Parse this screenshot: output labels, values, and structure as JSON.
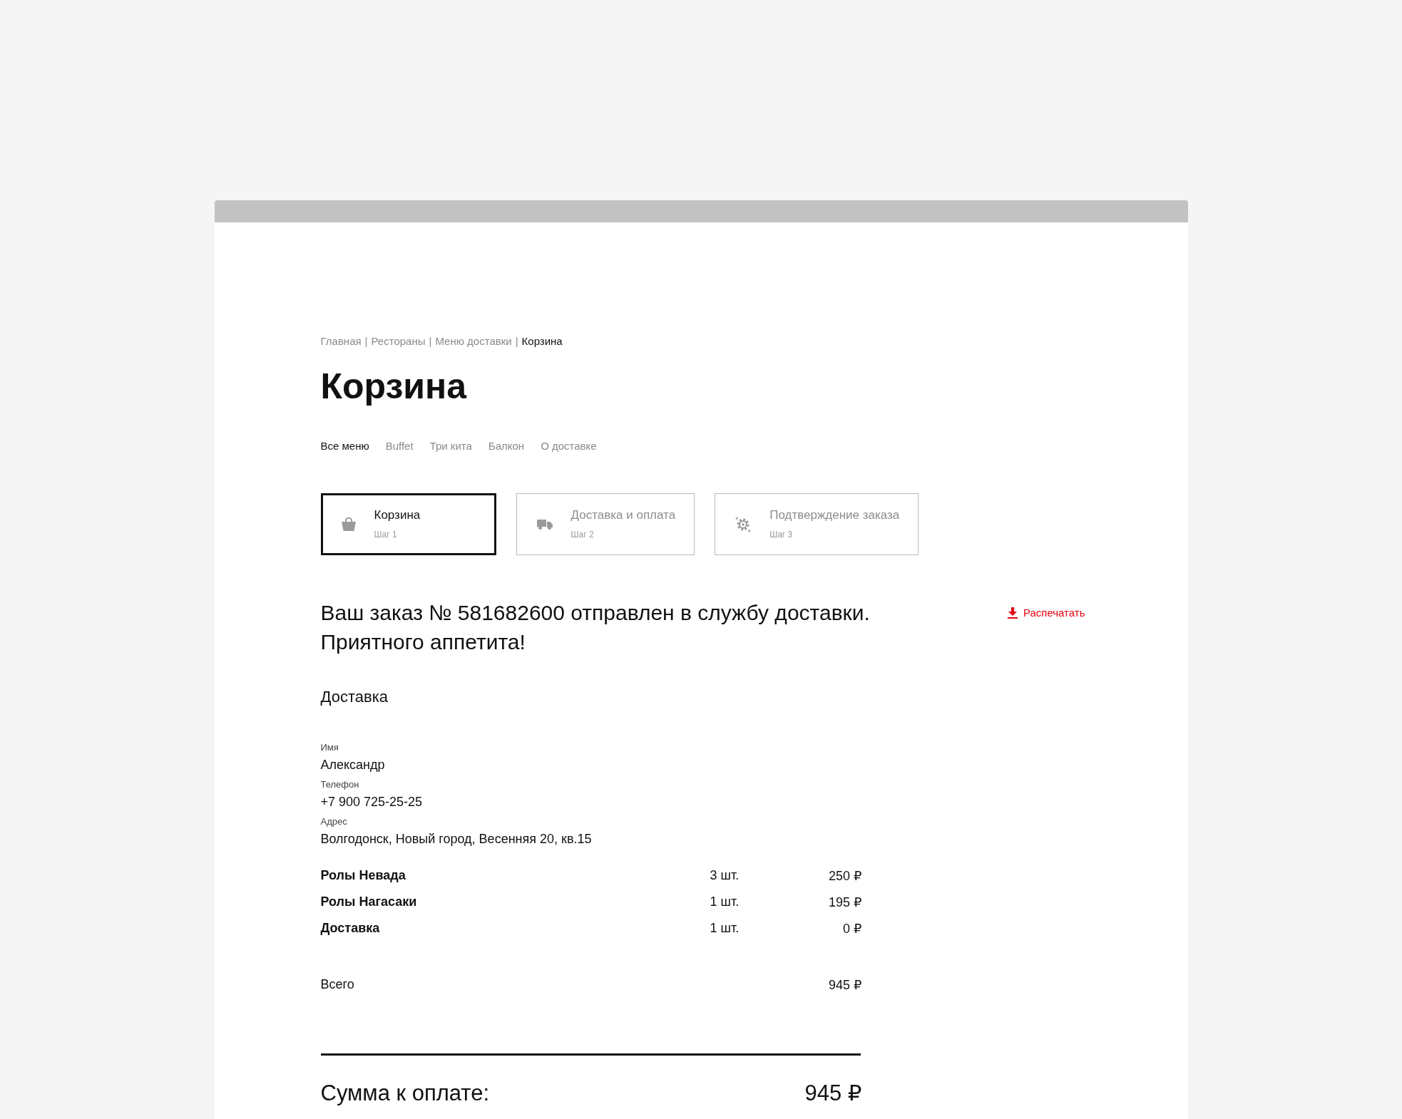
{
  "breadcrumbs": [
    {
      "label": "Главная",
      "separator": "|",
      "current": false
    },
    {
      "label": "Рестораны",
      "separator": "|",
      "current": false
    },
    {
      "label": "Меню доставки",
      "separator": "|",
      "current": false
    },
    {
      "label": "Корзина",
      "current": true
    }
  ],
  "title": "Корзина",
  "menu_tabs": [
    {
      "label": "Все меню",
      "selected": true
    },
    {
      "label": "Buffet",
      "selected": false
    },
    {
      "label": "Три кита",
      "selected": false
    },
    {
      "label": "Балкон",
      "selected": false
    },
    {
      "label": "О доставке",
      "selected": false
    }
  ],
  "steps": [
    {
      "kind": "basket",
      "title": "Корзина",
      "subtitle": "Шаг 1",
      "selected": true
    },
    {
      "kind": "truck",
      "title": "Доставка и оплата",
      "subtitle": "Шаг 2",
      "selected": false
    },
    {
      "kind": "gear",
      "title": "Подтверждение заказа",
      "subtitle": "Шаг 3",
      "selected": false
    }
  ],
  "message_lines": [
    "Ваш заказ № 581682600 отправлен в службу доставки.",
    "Приятного аппетита!"
  ],
  "print_link": {
    "label": "Распечатать"
  },
  "delivery": {
    "heading": "Доставка",
    "fields": [
      {
        "label": "Имя",
        "value": "Александр"
      },
      {
        "label": "Телефон",
        "value": "+7 900 725-25-25"
      },
      {
        "label": "Адрес",
        "value": "Волгодонск, Новый город, Весенняя 20, кв.15"
      }
    ]
  },
  "items": [
    {
      "name": "Ролы Невада",
      "quantity": "3 шт.",
      "price": "250 ₽"
    },
    {
      "name": "Ролы Нагасаки",
      "quantity": "1 шт.",
      "price": "195 ₽"
    },
    {
      "name": "Доставка",
      "quantity": "1 шт.",
      "price": "0 ₽"
    }
  ],
  "total": {
    "label": "Всего",
    "value": "945 ₽"
  },
  "amount_due": {
    "label": "Сумма к оплате:",
    "value": "945 ₽"
  }
}
